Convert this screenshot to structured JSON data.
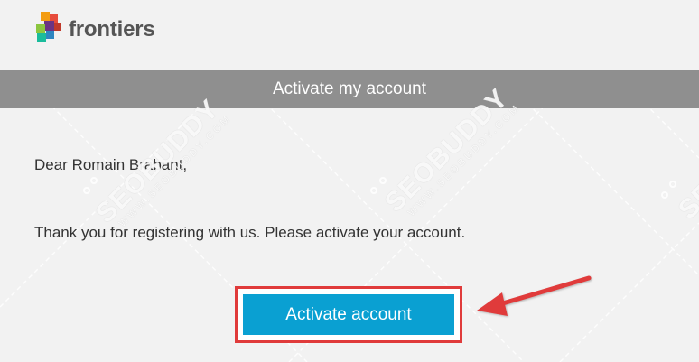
{
  "brand": {
    "name": "frontiers",
    "logo_icon": "frontiers-cubes-logo",
    "colors": {
      "orange": "#f39c12",
      "red": "#e74c3c",
      "green": "#8cc63f",
      "blue": "#2e86c1",
      "purple": "#6c3483",
      "teal": "#1abc9c"
    }
  },
  "banner": {
    "title": "Activate my account",
    "background": "#8f8f8f"
  },
  "email": {
    "greeting": "Dear Romain Brabant,",
    "message": "Thank you for registering with us. Please activate your account."
  },
  "cta": {
    "label": "Activate account",
    "color": "#0aa0d2",
    "highlight_color": "#e03b3b"
  },
  "annotation": {
    "arrow_icon": "red-arrow-icon",
    "color": "#e03b3b"
  },
  "watermark": {
    "text": "SEOBUDDY",
    "subtext": "WWW.SEOBUDDY.COM"
  }
}
